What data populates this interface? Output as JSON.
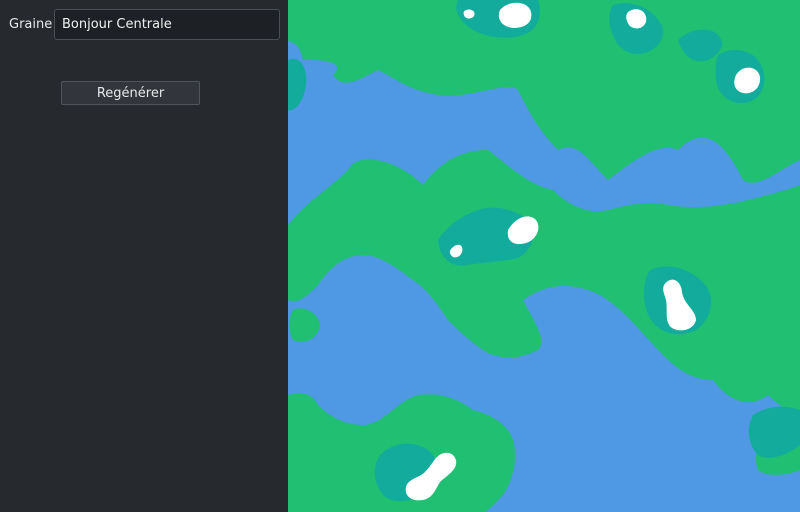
{
  "sidebar": {
    "seed_label": "Graine",
    "seed_value": "Bonjour Centrale",
    "regenerate_label": "Regénérer"
  },
  "map": {
    "colors": {
      "water": "#4f98e3",
      "land": "#20bf72",
      "highland": "#13ac9c",
      "snow": "#ffffff"
    }
  }
}
